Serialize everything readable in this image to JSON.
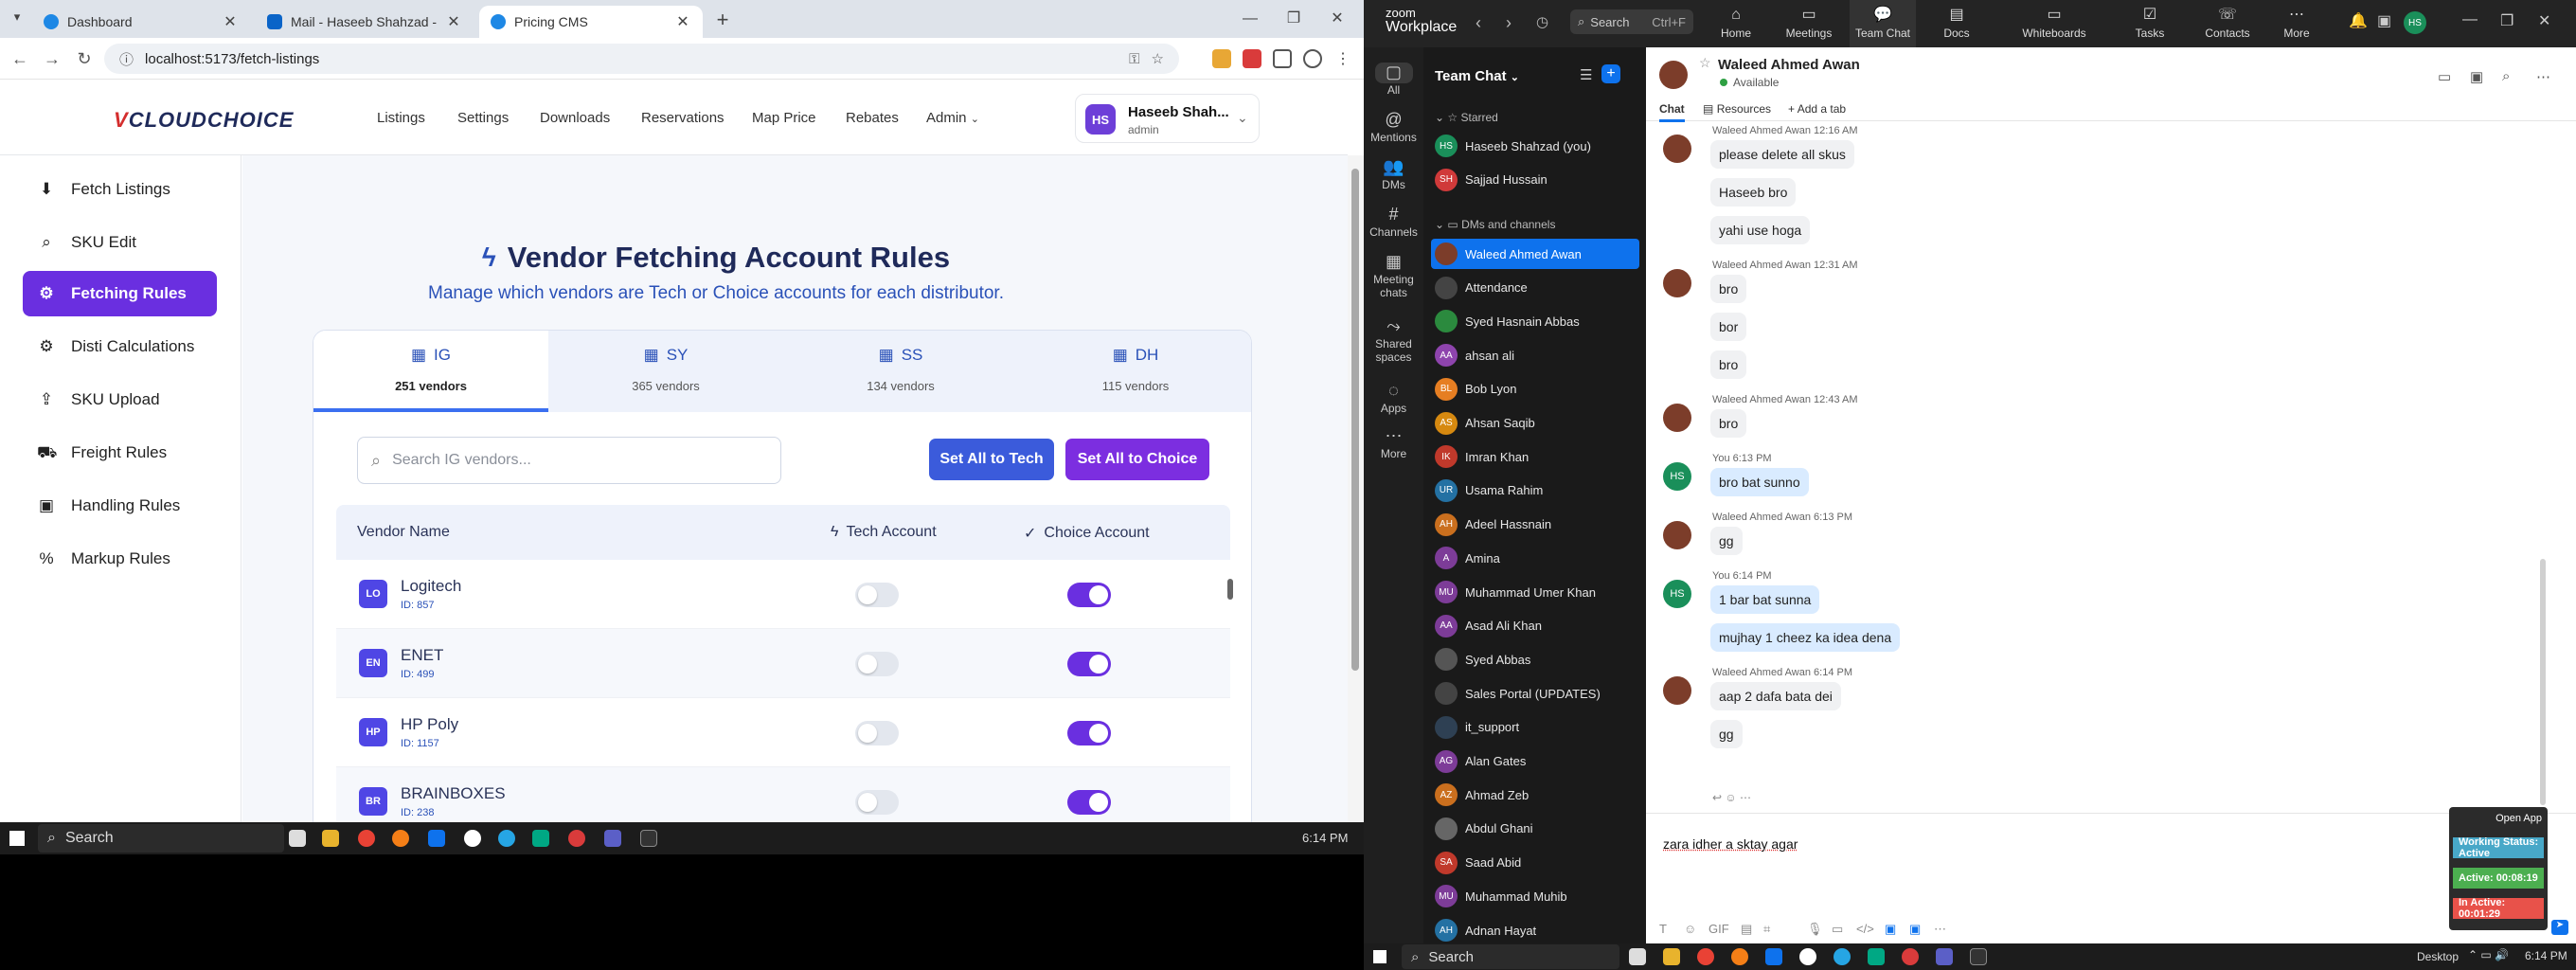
{
  "chrome": {
    "tabs": [
      {
        "title": "Dashboard",
        "color": "#1e88e5"
      },
      {
        "title": "Mail - Haseeb Shahzad - Outlo",
        "color": "#0a64c8"
      },
      {
        "title": "Pricing CMS",
        "color": "#1e88e5"
      }
    ],
    "url": "localhost:5173/fetch-listings"
  },
  "app": {
    "logo_prefix": "V",
    "logo_text": "CLOUDCHOICE",
    "nav": [
      "Listings",
      "Settings",
      "Downloads",
      "Reservations",
      "Map Price",
      "Rebates",
      "Admin"
    ],
    "user": {
      "initials": "HS",
      "name": "Haseeb Shah...",
      "role": "admin"
    },
    "sidebar": [
      {
        "label": "Fetch Listings",
        "icon": "download-icon"
      },
      {
        "label": "SKU Edit",
        "icon": "search-icon"
      },
      {
        "label": "Fetching Rules",
        "icon": "gear-icon"
      },
      {
        "label": "Disti Calculations",
        "icon": "gear-icon"
      },
      {
        "label": "SKU Upload",
        "icon": "upload-icon"
      },
      {
        "label": "Freight Rules",
        "icon": "truck-icon"
      },
      {
        "label": "Handling Rules",
        "icon": "box-icon"
      },
      {
        "label": "Markup Rules",
        "icon": "percent-icon"
      }
    ],
    "active_sidebar": "Fetching Rules",
    "page_title": "Vendor Fetching Account Rules",
    "page_subtitle": "Manage which vendors are Tech or Choice accounts for each distributor.",
    "distributors": [
      {
        "name": "IG",
        "count": "251 vendors"
      },
      {
        "name": "SY",
        "count": "365 vendors"
      },
      {
        "name": "SS",
        "count": "134 vendors"
      },
      {
        "name": "DH",
        "count": "115 vendors"
      }
    ],
    "search_placeholder": "Search IG vendors...",
    "btn_tech": "Set All to Tech",
    "btn_choice": "Set All to Choice",
    "table_headers": {
      "vendor": "Vendor Name",
      "tech": "Tech Account",
      "choice": "Choice Account"
    },
    "vendors": [
      {
        "initials": "LO",
        "name": "Logitech",
        "id": "ID: 857",
        "tech": false,
        "choice": true
      },
      {
        "initials": "EN",
        "name": "ENET",
        "id": "ID: 499",
        "tech": false,
        "choice": true
      },
      {
        "initials": "HP",
        "name": "HP Poly",
        "id": "ID: 1157",
        "tech": false,
        "choice": true
      },
      {
        "initials": "BR",
        "name": "BRAINBOXES",
        "id": "ID: 238",
        "tech": false,
        "choice": true
      }
    ]
  },
  "taskbar_left": {
    "search": "Search",
    "time": "6:14 PM"
  },
  "zoom": {
    "logo_line1": "zoom",
    "logo_line2": "Workplace",
    "search": "Search",
    "search_shortcut": "Ctrl+F",
    "top_tabs": [
      "Home",
      "Meetings",
      "Team Chat",
      "Docs",
      "Whiteboards",
      "Tasks",
      "Contacts",
      "More"
    ],
    "active_top_tab": "Team Chat",
    "rail": [
      "All",
      "Mentions",
      "DMs",
      "Channels",
      "Meeting chats",
      "Shared spaces",
      "Apps",
      "More"
    ],
    "list_title": "Team Chat",
    "starred_label": "Starred",
    "dms_label": "DMs and channels",
    "starred": [
      {
        "initials": "HS",
        "name": "Haseeb Shahzad (you)",
        "color": "#1a8f5a"
      },
      {
        "initials": "SH",
        "name": "Sajjad Hussain",
        "color": "#d03a3a"
      }
    ],
    "dms": [
      {
        "initials": "",
        "name": "Waleed Ahmed Awan",
        "color": "#7c3d2a",
        "active": true
      },
      {
        "initials": "",
        "name": "Attendance",
        "color": "#444"
      },
      {
        "initials": "",
        "name": "Syed Hasnain Abbas",
        "color": "#2b8a3e"
      },
      {
        "initials": "AA",
        "name": "ahsan ali",
        "color": "#8e44ad"
      },
      {
        "initials": "BL",
        "name": "Bob Lyon",
        "color": "#e67e22"
      },
      {
        "initials": "AS",
        "name": "Ahsan Saqib",
        "color": "#d68910"
      },
      {
        "initials": "IK",
        "name": "Imran Khan",
        "color": "#c0392b"
      },
      {
        "initials": "UR",
        "name": "Usama Rahim",
        "color": "#2471a3"
      },
      {
        "initials": "AH",
        "name": "Adeel Hassnain",
        "color": "#ca6f1e"
      },
      {
        "initials": "A",
        "name": "Amina",
        "color": "#7d3c98"
      },
      {
        "initials": "MU",
        "name": "Muhammad Umer Khan",
        "color": "#7d3c98"
      },
      {
        "initials": "AA",
        "name": "Asad Ali Khan",
        "color": "#7d3c98"
      },
      {
        "initials": "",
        "name": "Syed Abbas",
        "color": "#555"
      },
      {
        "initials": "",
        "name": "Sales Portal (UPDATES)",
        "color": "#444"
      },
      {
        "initials": "",
        "name": "it_support",
        "color": "#2e4053"
      },
      {
        "initials": "AG",
        "name": "Alan Gates",
        "color": "#7d3c98"
      },
      {
        "initials": "AZ",
        "name": "Ahmad Zeb",
        "color": "#ca6f1e"
      },
      {
        "initials": "",
        "name": "Abdul Ghani",
        "color": "#666"
      },
      {
        "initials": "SA",
        "name": "Saad Abid",
        "color": "#c0392b"
      },
      {
        "initials": "MU",
        "name": "Muhammad Muhib",
        "color": "#7d3c98"
      },
      {
        "initials": "AH",
        "name": "Adnan Hayat",
        "color": "#2471a3"
      }
    ],
    "chat": {
      "name": "Waleed Ahmed Awan",
      "status": "Available",
      "tabs": [
        "Chat",
        "Resources",
        "Add a tab"
      ],
      "messages": [
        {
          "sender": "Waleed Ahmed Awan",
          "time": "12:16 AM",
          "texts": [
            "please delete all skus",
            "Haseeb bro",
            "yahi use hoga"
          ],
          "me": false
        },
        {
          "sender": "Waleed Ahmed Awan",
          "time": "12:31 AM",
          "texts": [
            "bro",
            "bor",
            "bro"
          ],
          "me": false
        },
        {
          "sender": "Waleed Ahmed Awan",
          "time": "12:43 AM",
          "texts": [
            "bro"
          ],
          "me": false
        },
        {
          "sender": "You",
          "time": "6:13 PM",
          "texts": [
            "bro bat sunno"
          ],
          "me": true
        },
        {
          "sender": "Waleed Ahmed Awan",
          "time": "6:13 PM",
          "texts": [
            "gg"
          ],
          "me": false
        },
        {
          "sender": "You",
          "time": "6:14 PM",
          "texts": [
            "1 bar bat sunna",
            "mujhay 1 cheez ka idea dena"
          ],
          "me": true
        },
        {
          "sender": "Waleed Ahmed Awan",
          "time": "6:14 PM",
          "texts": [
            "aap 2 dafa bata dei",
            "gg"
          ],
          "me": false
        }
      ],
      "draft": "zara idher a sktay agar"
    },
    "status_widget": {
      "open": "Open App",
      "working": "Working Status: Active",
      "active": "Active: 00:08:19",
      "inactive": "In Active: 00:01:29"
    },
    "taskbar": {
      "search": "Search",
      "desktop": "Desktop",
      "time": "6:14 PM"
    }
  }
}
